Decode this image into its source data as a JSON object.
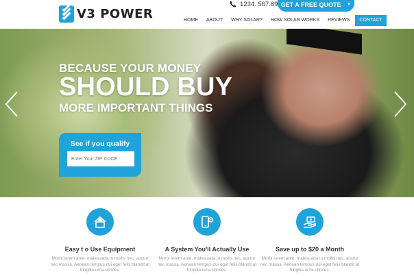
{
  "header": {
    "logo_text": "V3 POWER",
    "logo_mark_text": "V3",
    "phone": "1234. 567.890",
    "quote_button": "GET A FREE QUOTE",
    "nav": [
      "HOME",
      "ABOUT",
      "WHY SOLAR?",
      "HOW SOLAR WORKS",
      "REVIEWS",
      "CONTACT"
    ],
    "active_nav": "CONTACT"
  },
  "hero": {
    "line1": "BECAUSE YOUR MONEY",
    "line2": "SHOULD BUY",
    "line3": "MORE IMPORTANT THINGS",
    "qualify_title": "See if you qualify",
    "zip_placeholder": "Enter Your ZIP CODE",
    "prev_icon": "chevron-left-icon",
    "next_icon": "chevron-right-icon"
  },
  "features": [
    {
      "icon": "solar-house-icon",
      "title": "Easy t o Use Equipment",
      "desc": "Morbi lorem ante, malesuada in mollis nec, auctor nec massa. Aenean tempus dui eget felis blandit at fringilla urna ultrices."
    },
    {
      "icon": "mobile-settings-icon",
      "title": "A System You'll Actually Use",
      "desc": "Morbi lorem ante, malesuada in mollis nec, auctor nec massa. Aenean tempus dui eget felis blandit at fringilla urna ultrices."
    },
    {
      "icon": "money-hand-icon",
      "title": "Save up to $20 a Month",
      "desc": "Morbi lorem ante, malesuada in mollis nec, auctor nec massa. Aenean tempus dui eget felis blandit at fringilla urna ultrices."
    }
  ],
  "colors": {
    "accent": "#1fa3d8",
    "text": "#333333",
    "muted": "#999999"
  }
}
